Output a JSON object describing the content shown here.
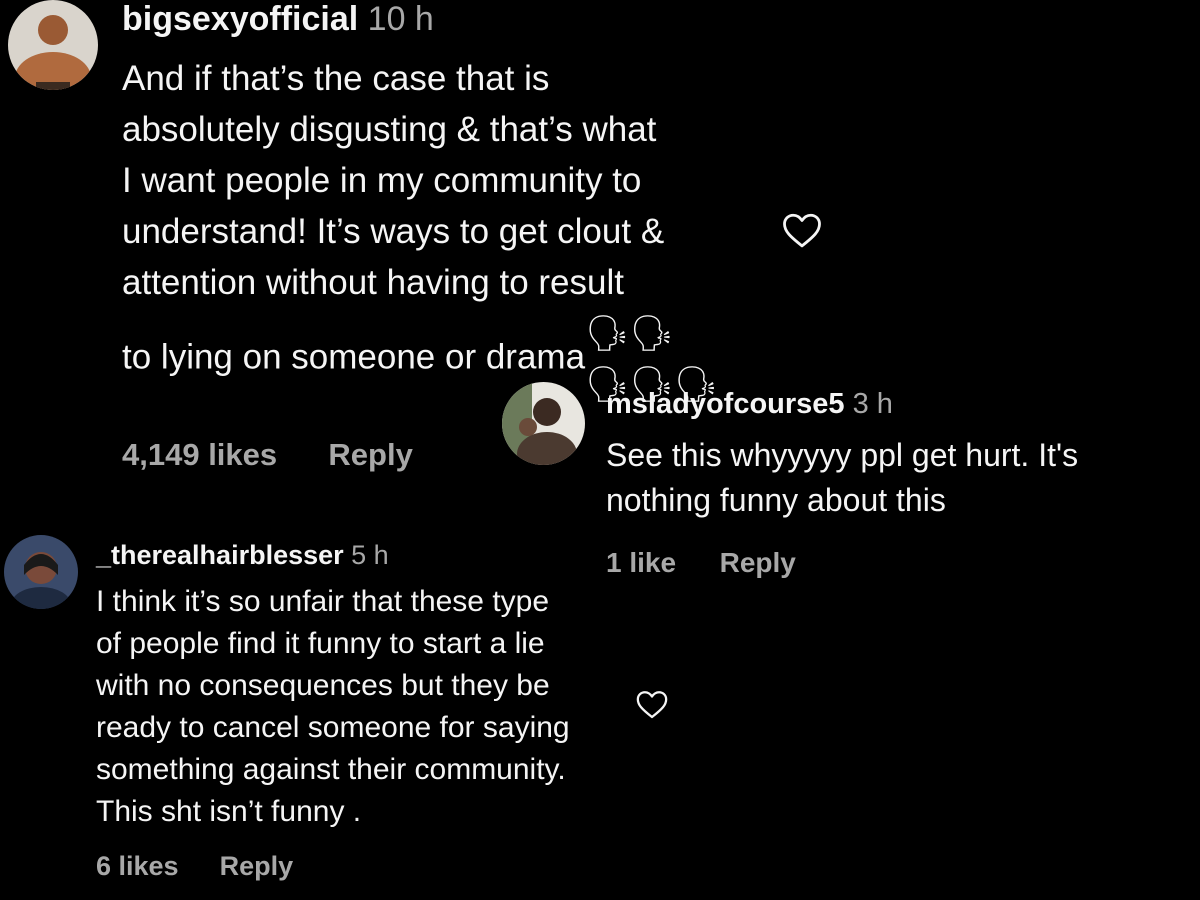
{
  "comments": [
    {
      "username": "bigsexyofficial",
      "time": "10 h",
      "text": "And if that’s the case that is\nabsolutely disgusting & that’s what\nI want people in my community to\nunderstand! It’s ways to get clout &\nattention without having to result\nto lying on someone or drama",
      "emojis": "🗣🗣\n🗣🗣🗣",
      "likes": "4,149 likes",
      "reply": "Reply",
      "avatar_icon": "person-avatar-icon"
    },
    {
      "username": "msladyofcourse5",
      "time": "3 h",
      "text": "See this whyyyyy ppl get hurt. It's\nnothing funny about this",
      "likes": "1 like",
      "reply": "Reply",
      "avatar_icon": "person-avatar-icon"
    },
    {
      "username": "_therealhairblesser",
      "time": "5 h",
      "text": "I think it’s so unfair that these type\nof people find it funny to start a lie\nwith no consequences but they be\nready to cancel someone for saying\nsomething against their community.\nThis sht isn’t funny .",
      "likes": "6 likes",
      "reply": "Reply",
      "avatar_icon": "person-avatar-icon"
    }
  ],
  "icons": {
    "like": "heart-outline-icon"
  },
  "colors": {
    "background": "#000000",
    "text": "#f5f5f5",
    "secondary": "#a8a8a8"
  }
}
